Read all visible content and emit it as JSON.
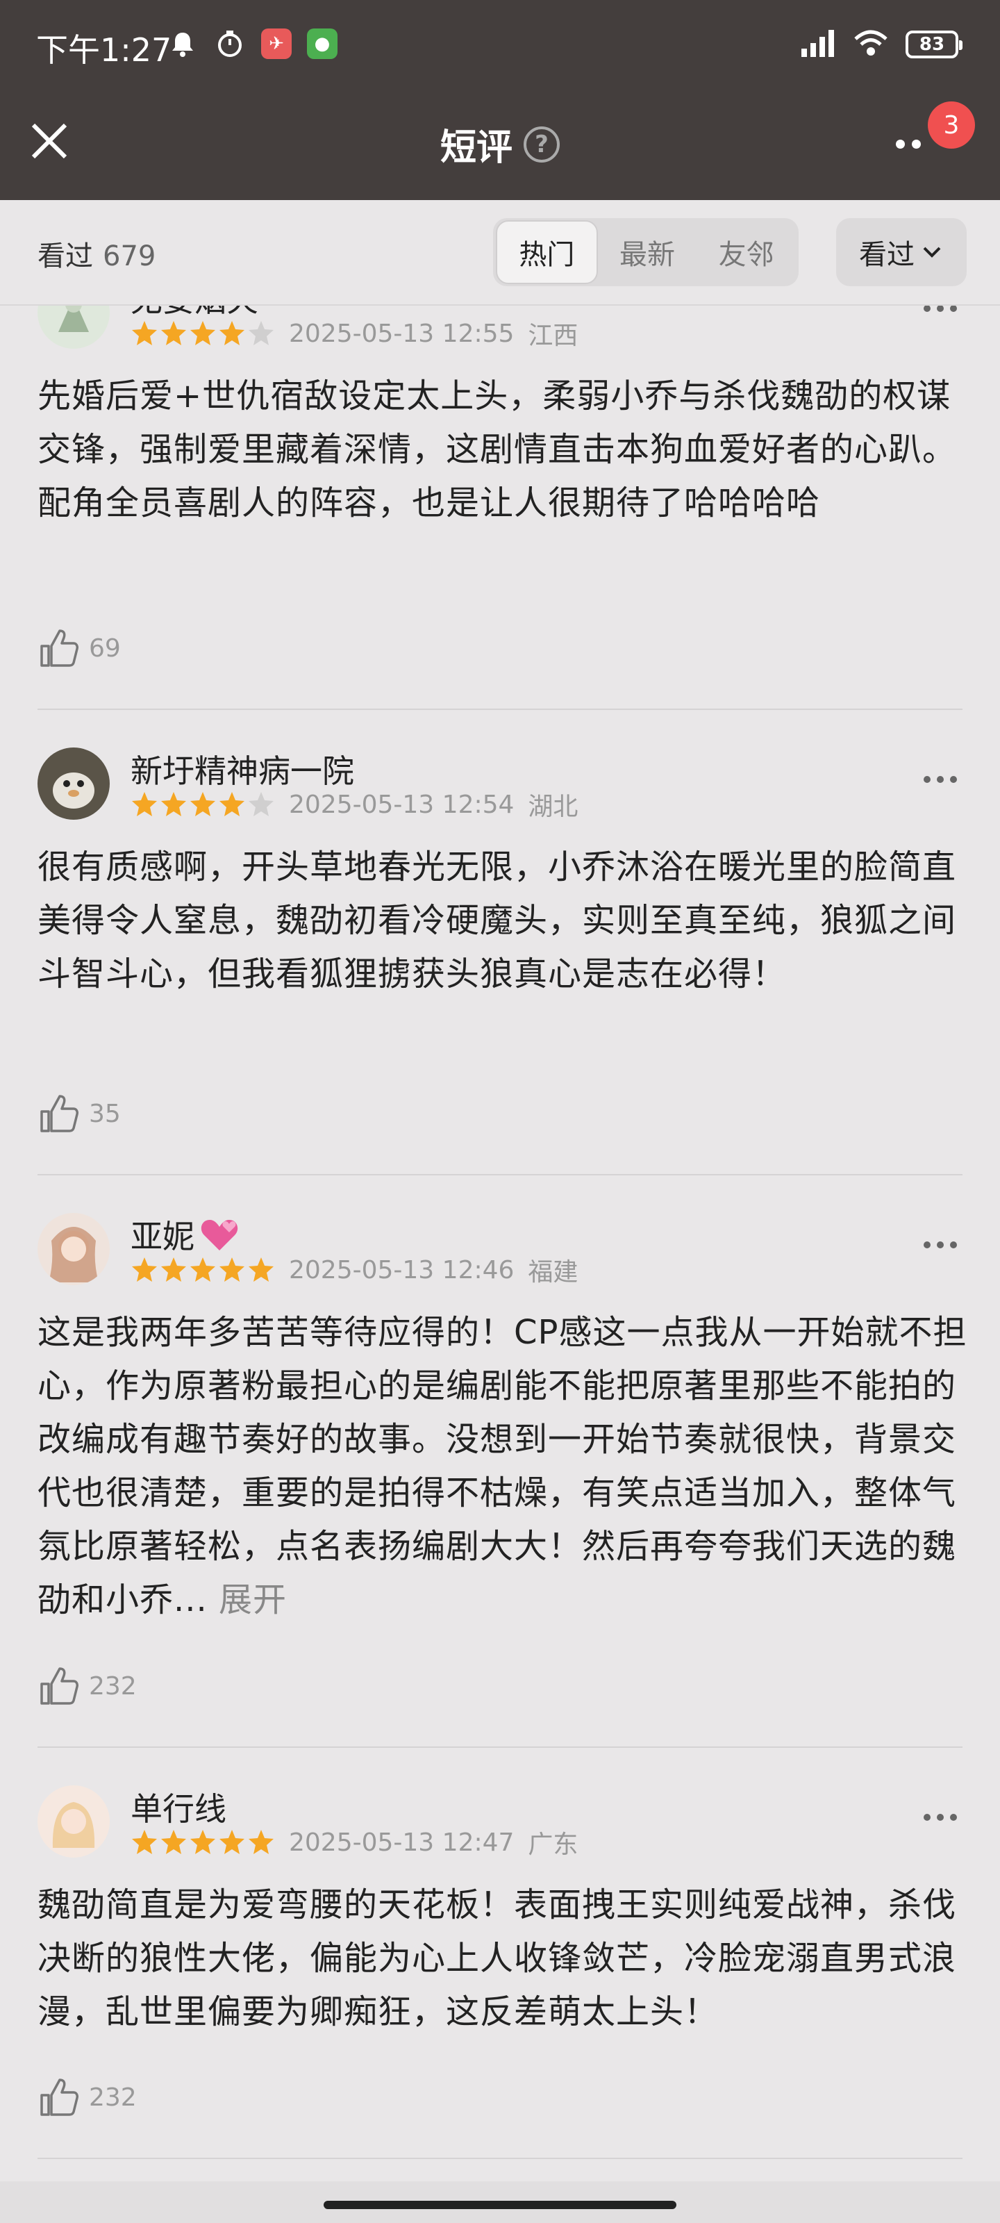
{
  "status_bar": {
    "time": "下午1:27",
    "battery": "83"
  },
  "nav": {
    "title": "短评",
    "help_symbol": "?",
    "badge_count": "3"
  },
  "filter": {
    "seen_label": "看过",
    "seen_count": "679",
    "tabs": [
      "热门",
      "最新",
      "友邻"
    ],
    "active_tab": "热门",
    "dropdown_label": "看过"
  },
  "reviews": [
    {
      "name": "无妄烟火",
      "stars": 4,
      "date": "2025-05-13 12:55",
      "location": "江西",
      "text": "先婚后爱+世仇宿敌设定太上头，柔弱小乔与杀伐魏劭的权谋交锋，强制爱里藏着深情，这剧情直击本狗血爱好者的心趴。配角全员喜剧人的阵容，也是让人很期待了哈哈哈哈",
      "likes": "69"
    },
    {
      "name": "新圩精神病一院",
      "stars": 4,
      "date": "2025-05-13 12:54",
      "location": "湖北",
      "text": "很有质感啊，开头草地春光无限，小乔沐浴在暖光里的脸简直美得令人窒息，魏劭初看冷硬魔头，实则至真至纯，狼狐之间斗智斗心，但我看狐狸掳获头狼真心是志在必得！",
      "likes": "35"
    },
    {
      "name": "亚妮",
      "name_emoji": "💕",
      "stars": 5,
      "date": "2025-05-13 12:46",
      "location": "福建",
      "text": "这是我两年多苦苦等待应得的！CP感这一点我从一开始就不担心，作为原著粉最担心的是编剧能不能把原著里那些不能拍的改编成有趣节奏好的故事。没想到一开始节奏就很快，背景交代也很清楚，重要的是拍得不枯燥，有笑点适当加入，整体气氛比原著轻松，点名表扬编剧大大！然后再夸夸我们天选的魏劭和小乔...",
      "expand_label": "展开",
      "likes": "232"
    },
    {
      "name": "单行线",
      "stars": 5,
      "date": "2025-05-13 12:47",
      "location": "广东",
      "text": "魏劭简直是为爱弯腰的天花板！表面拽王实则纯爱战神，杀伐决断的狼性大佬，偏能为心上人收锋敛芒，冷脸宠溺直男式浪漫，乱世里偏要为卿痴狂，这反差萌太上头！",
      "likes": "232"
    }
  ],
  "colors": {
    "header_bg": "#443e3d",
    "page_bg": "#e9e7e8",
    "star_filled": "#f5a623",
    "star_empty": "#d0cfcf",
    "badge": "#f05050"
  }
}
